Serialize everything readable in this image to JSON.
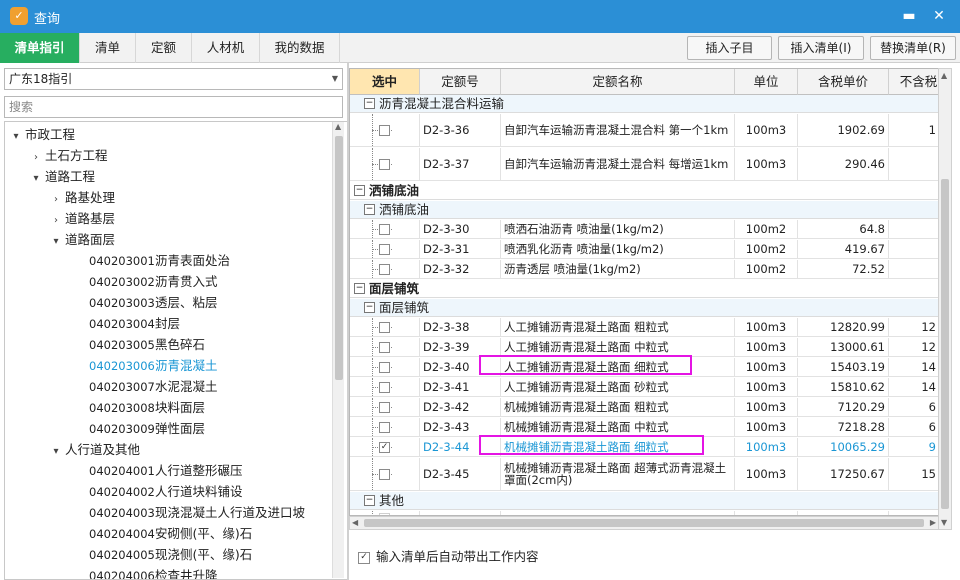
{
  "window": {
    "title": "查询",
    "logo": "app-logo",
    "minimize": "▬",
    "close": "✕"
  },
  "tabs": [
    {
      "label": "清单指引",
      "active": true
    },
    {
      "label": "清单"
    },
    {
      "label": "定额"
    },
    {
      "label": "人材机"
    },
    {
      "label": "我的数据"
    }
  ],
  "toolbar": {
    "insert_child": "插入子目",
    "insert_list": "插入清单(I)",
    "replace_list": "替换清单(R)"
  },
  "left": {
    "dropdown_value": "广东18指引",
    "search_placeholder": "搜索",
    "tree": [
      {
        "arrow": "▾",
        "label": "市政工程"
      },
      {
        "arrow": "›",
        "label": "土石方工程"
      },
      {
        "arrow": "▾",
        "label": "道路工程"
      },
      {
        "arrow": "›",
        "label": "路基处理"
      },
      {
        "arrow": "›",
        "label": "道路基层"
      },
      {
        "arrow": "▾",
        "label": "道路面层"
      },
      {
        "code": "040203001",
        "label": "沥青表面处治"
      },
      {
        "code": "040203002",
        "label": "沥青贯入式"
      },
      {
        "code": "040203003",
        "label": "透层、粘层"
      },
      {
        "code": "040203004",
        "label": "封层"
      },
      {
        "code": "040203005",
        "label": "黑色碎石"
      },
      {
        "code": "040203006",
        "label": "沥青混凝土",
        "selected": true
      },
      {
        "code": "040203007",
        "label": "水泥混凝土"
      },
      {
        "code": "040203008",
        "label": "块料面层"
      },
      {
        "code": "040203009",
        "label": "弹性面层"
      },
      {
        "arrow": "▾",
        "label": "人行道及其他"
      },
      {
        "code": "040204001",
        "label": "人行道整形碾压"
      },
      {
        "code": "040204002",
        "label": "人行道块料铺设"
      },
      {
        "code": "040204003",
        "label": "现浇混凝土人行道及进口坡"
      },
      {
        "code": "040204004",
        "label": "安砌侧(平、缘)石"
      },
      {
        "code": "040204005",
        "label": "现浇侧(平、缘)石"
      },
      {
        "code": "040204006",
        "label": "检查井升降"
      }
    ]
  },
  "grid": {
    "headers": [
      "选中",
      "定额号",
      "定额名称",
      "单位",
      "含税单价",
      "不含税"
    ],
    "rows": [
      {
        "kind": "group2",
        "label": "沥青混凝土混合料运输"
      },
      {
        "kind": "item",
        "code": "D2-3-36",
        "name": "自卸汽车运输沥青混凝土混合料 第一个1km",
        "unit": "100m3",
        "price": "1902.69",
        "price2": "1",
        "tall": true
      },
      {
        "kind": "item",
        "code": "D2-3-37",
        "name": "自卸汽车运输沥青混凝土混合料 每增运1km",
        "unit": "100m3",
        "price": "290.46",
        "price2": "",
        "tall": true
      },
      {
        "kind": "group1",
        "label": "洒铺底油"
      },
      {
        "kind": "group2",
        "label": "洒铺底油"
      },
      {
        "kind": "item",
        "code": "D2-3-30",
        "name": "喷洒石油沥青 喷油量(1kg/m2)",
        "unit": "100m2",
        "price": "64.8",
        "price2": ""
      },
      {
        "kind": "item",
        "code": "D2-3-31",
        "name": "喷洒乳化沥青 喷油量(1kg/m2)",
        "unit": "100m2",
        "price": "419.67",
        "price2": ""
      },
      {
        "kind": "item",
        "code": "D2-3-32",
        "name": "沥青透层 喷油量(1kg/m2)",
        "unit": "100m2",
        "price": "72.52",
        "price2": ""
      },
      {
        "kind": "group1",
        "label": "面层铺筑"
      },
      {
        "kind": "group2",
        "label": "面层铺筑"
      },
      {
        "kind": "item",
        "code": "D2-3-38",
        "name": "人工摊铺沥青混凝土路面 粗粒式",
        "unit": "100m3",
        "price": "12820.99",
        "price2": "12"
      },
      {
        "kind": "item",
        "code": "D2-3-39",
        "name": "人工摊铺沥青混凝土路面 中粒式",
        "unit": "100m3",
        "price": "13000.61",
        "price2": "12"
      },
      {
        "kind": "item",
        "code": "D2-3-40",
        "name": "人工摊铺沥青混凝土路面 细粒式",
        "unit": "100m3",
        "price": "15403.19",
        "price2": "14",
        "marked": true
      },
      {
        "kind": "item",
        "code": "D2-3-41",
        "name": "人工摊铺沥青混凝土路面 砂粒式",
        "unit": "100m3",
        "price": "15810.62",
        "price2": "14"
      },
      {
        "kind": "item",
        "code": "D2-3-42",
        "name": "机械摊铺沥青混凝土路面 粗粒式",
        "unit": "100m3",
        "price": "7120.29",
        "price2": "6"
      },
      {
        "kind": "item",
        "code": "D2-3-43",
        "name": "机械摊铺沥青混凝土路面 中粒式",
        "unit": "100m3",
        "price": "7218.28",
        "price2": "6"
      },
      {
        "kind": "item",
        "code": "D2-3-44",
        "name": "机械摊铺沥青混凝土路面 细粒式",
        "unit": "100m3",
        "price": "10065.29",
        "price2": "9",
        "checked": true,
        "highlight": true,
        "marked": true
      },
      {
        "kind": "item",
        "code": "D2-3-45",
        "name": "机械摊铺沥青混凝土路面 超薄式沥青混凝土罩面(2cm内)",
        "unit": "100m3",
        "price": "17250.67",
        "price2": "15",
        "tall": true
      },
      {
        "kind": "group2",
        "label": "其他"
      },
      {
        "kind": "empty"
      }
    ]
  },
  "footer": {
    "auto_bring_label": "输入清单后自动带出工作内容",
    "checked": true
  },
  "colors": {
    "titlebar": "#2b8fd6",
    "active_tab": "#27ae60",
    "selected_text": "#1a96d4",
    "marker": "#e414e4",
    "header_selected": "#ffe6b0"
  }
}
